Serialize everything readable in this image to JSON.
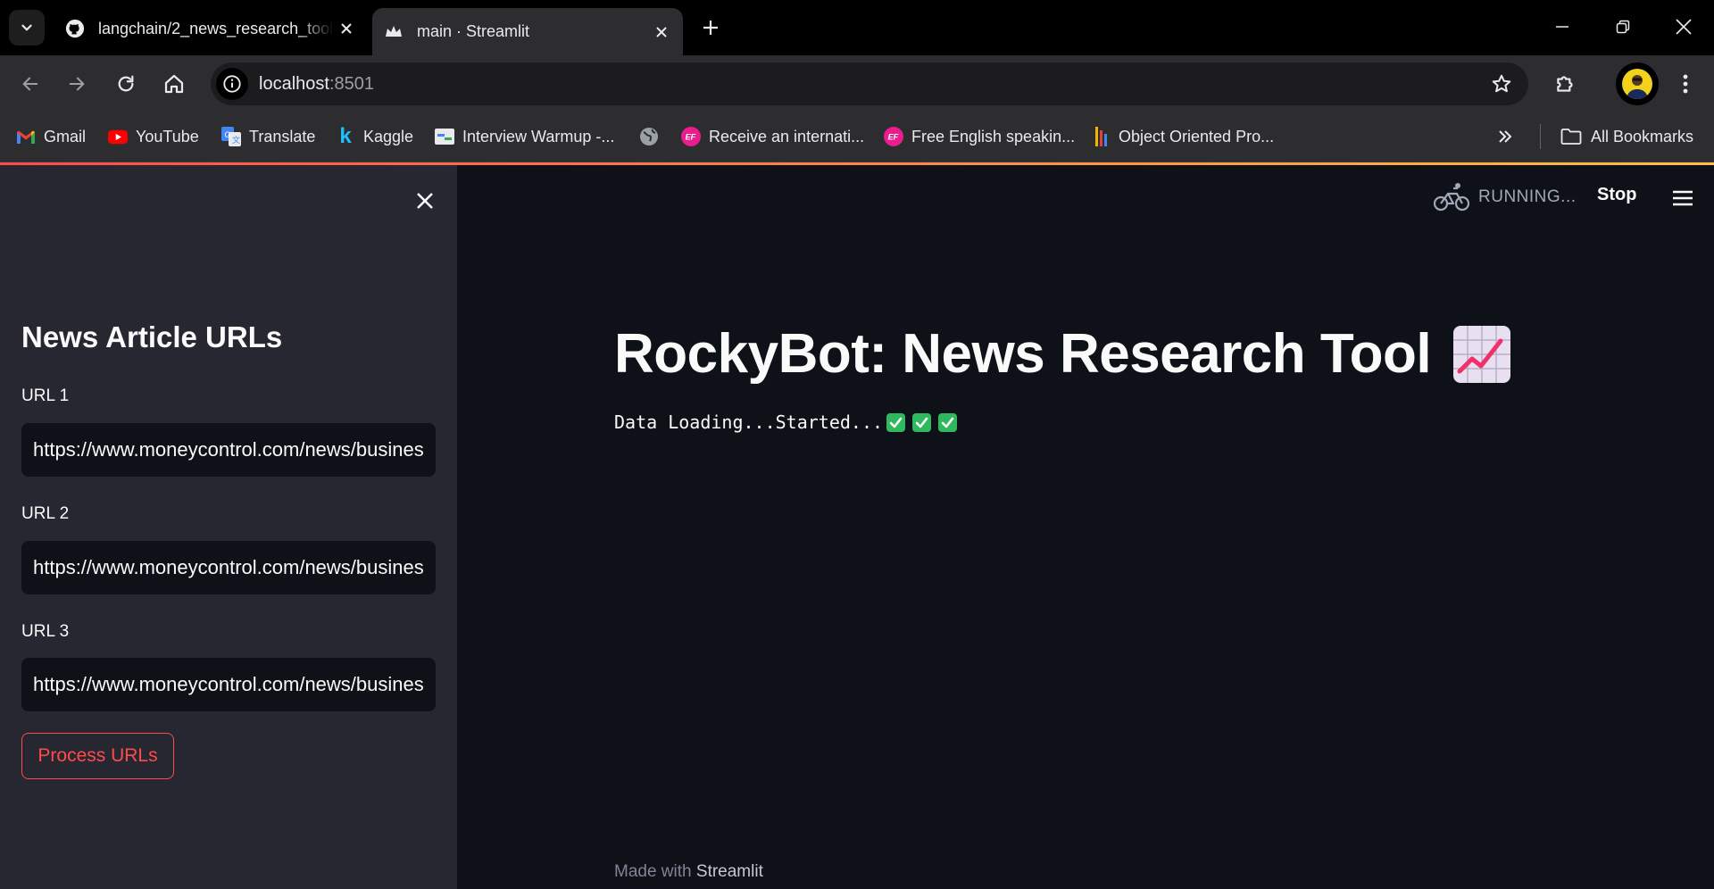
{
  "browser": {
    "tabs": [
      {
        "title": "langchain/2_news_research_tool",
        "icon": "github-icon"
      },
      {
        "title": "main · Streamlit",
        "icon": "streamlit-crown-icon"
      }
    ],
    "address": {
      "host": "localhost",
      "port": ":8501"
    },
    "bookmarks": [
      {
        "label": "Gmail",
        "icon": "gmail-icon"
      },
      {
        "label": "YouTube",
        "icon": "youtube-icon"
      },
      {
        "label": "Translate",
        "icon": "translate-icon"
      },
      {
        "label": "Kaggle",
        "icon": "kaggle-icon"
      },
      {
        "label": "Interview Warmup -...",
        "icon": "interview-icon"
      },
      {
        "label": "",
        "icon": "globe-icon"
      },
      {
        "label": "Receive an internati...",
        "icon": "ef-icon"
      },
      {
        "label": "Free English speakin...",
        "icon": "ef-icon"
      },
      {
        "label": "Object Oriented Pro...",
        "icon": "oop-icon"
      }
    ],
    "all_bookmarks_label": "All Bookmarks"
  },
  "sidebar": {
    "heading": "News Article URLs",
    "fields": [
      {
        "label": "URL 1",
        "value": "https://www.moneycontrol.com/news/business/"
      },
      {
        "label": "URL 2",
        "value": "https://www.moneycontrol.com/news/business/"
      },
      {
        "label": "URL 3",
        "value": "https://www.moneycontrol.com/news/business/"
      }
    ],
    "process_button": "Process URLs"
  },
  "header": {
    "status": "RUNNING...",
    "stop_label": "Stop"
  },
  "main": {
    "title": "RockyBot: News Research Tool",
    "title_emoji": "chart-increasing-icon",
    "loading_text": "Data Loading...Started...",
    "loading_checks": 3,
    "footer_prefix": "Made with",
    "footer_brand": "Streamlit"
  },
  "colors": {
    "primary": "#ff4b4b",
    "sidebar_bg": "#262730",
    "app_bg": "#0e1117",
    "check_green": "#2fb85e"
  }
}
